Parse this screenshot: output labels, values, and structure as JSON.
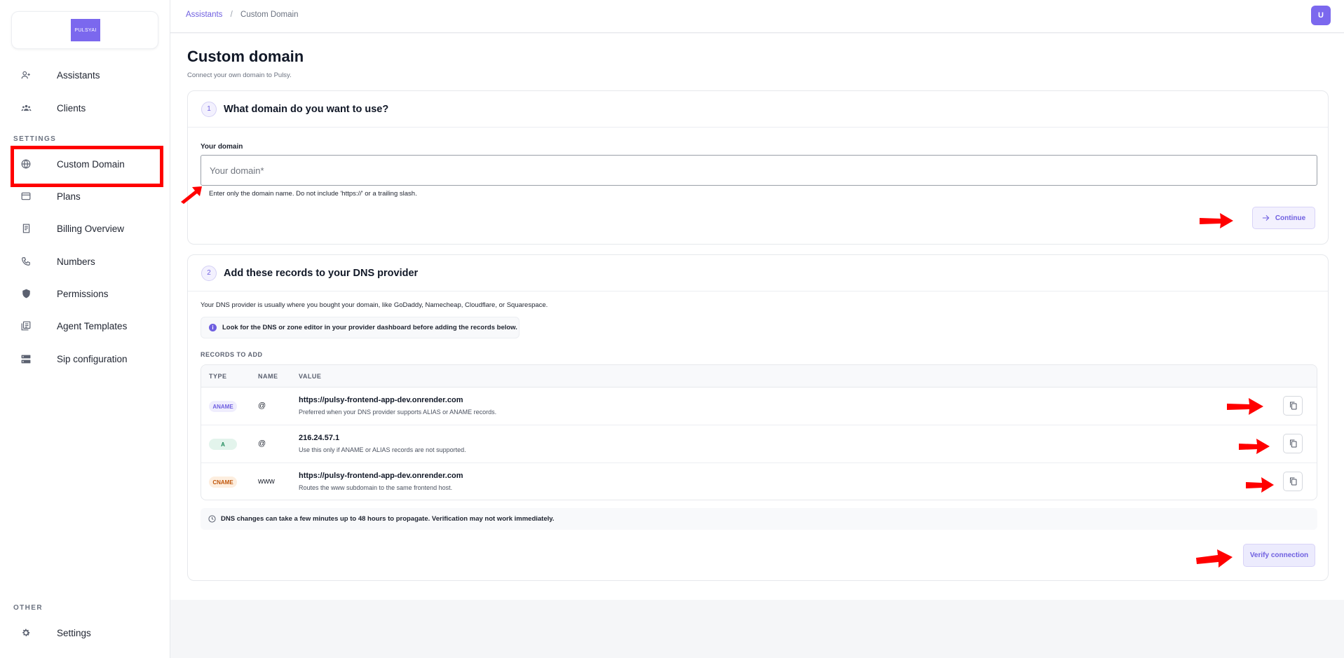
{
  "brand": {
    "logo_text": "PULSYAI"
  },
  "sidebar": {
    "items_top": [
      {
        "label": "Assistants",
        "icon": "person-add-icon"
      },
      {
        "label": "Clients",
        "icon": "group-icon"
      }
    ],
    "settings_label": "SETTINGS",
    "settings_items": [
      {
        "label": "Custom Domain",
        "icon": "globe-icon"
      },
      {
        "label": "Plans",
        "icon": "credit-card-icon"
      },
      {
        "label": "Billing Overview",
        "icon": "receipt-icon"
      },
      {
        "label": "Numbers",
        "icon": "phone-icon"
      },
      {
        "label": "Permissions",
        "icon": "shield-icon"
      },
      {
        "label": "Agent Templates",
        "icon": "library-icon"
      },
      {
        "label": "Sip configuration",
        "icon": "server-icon"
      }
    ],
    "other_label": "OTHER",
    "other_items": [
      {
        "label": "Settings",
        "icon": "gear-icon"
      }
    ]
  },
  "topbar": {
    "breadcrumb": {
      "parent": "Assistants",
      "separator": "/",
      "current": "Custom Domain"
    },
    "avatar_initial": "U"
  },
  "page": {
    "title": "Custom domain",
    "subtitle": "Connect your own domain to Pulsy."
  },
  "step1": {
    "number": "1",
    "title": "What domain do you want to use?",
    "field_label": "Your domain",
    "input_placeholder": "Your domain*",
    "input_value": "",
    "helper": "Enter only the domain name. Do not include 'https://' or a trailing slash.",
    "continue_label": "Continue"
  },
  "step2": {
    "number": "2",
    "title": "Add these records to your DNS provider",
    "intro": "Your DNS provider is usually where you bought your domain, like GoDaddy, Namecheap, Cloudflare, or Squarespace.",
    "info": "Look for the DNS or zone editor in your provider dashboard before adding the records below.",
    "records_label": "RECORDS TO ADD",
    "columns": {
      "type": "TYPE",
      "name": "NAME",
      "value": "VALUE"
    },
    "records": [
      {
        "type": "ANAME",
        "name": "@",
        "value": "https://pulsy-frontend-app-dev.onrender.com",
        "note": "Preferred when your DNS provider supports ALIAS or ANAME records."
      },
      {
        "type": "A",
        "name": "@",
        "value": "216.24.57.1",
        "note": "Use this only if ANAME or ALIAS records are not supported."
      },
      {
        "type": "CNAME",
        "name": "www",
        "value": "https://pulsy-frontend-app-dev.onrender.com",
        "note": "Routes the www subdomain to the same frontend host."
      }
    ],
    "propagation_note": "DNS changes can take a few minutes up to 48 hours to propagate. Verification may not work immediately.",
    "verify_label": "Verify connection"
  },
  "colors": {
    "accent": "#7b68ee",
    "annotation": "#ff0000"
  }
}
